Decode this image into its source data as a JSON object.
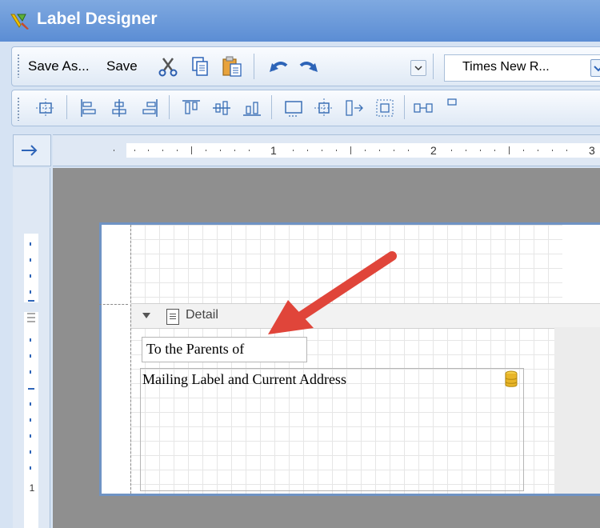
{
  "window": {
    "title": "Label Designer"
  },
  "toolbar": {
    "save_as_label": "Save As...",
    "save_label": "Save",
    "font_name": "Times New R..."
  },
  "ruler": {
    "marks": [
      "1",
      "2",
      "3"
    ],
    "vertical_mark": "1"
  },
  "designer": {
    "band_label": "Detail",
    "field1_text": "To the Parents of",
    "field2_text": "Mailing Label and Current Address"
  },
  "colors": {
    "title_bar": "#5b8dd4",
    "annotation_arrow": "#e0453a",
    "canvas": "#8f8f8f"
  }
}
